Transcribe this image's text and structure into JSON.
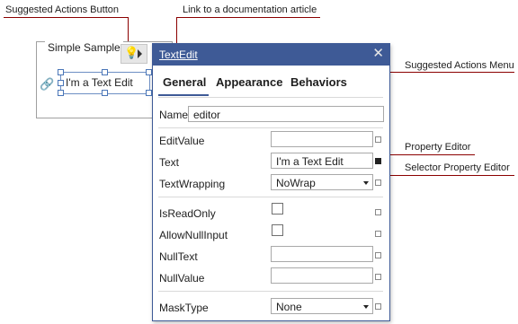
{
  "annotations": {
    "suggested_actions_button": "Suggested Actions Button",
    "link_to_doc": "Link to a documentation article",
    "suggested_actions_menu": "Suggested Actions Menu",
    "property_editor": "Property Editor",
    "selector_property_editor": "Selector Property Editor"
  },
  "designer": {
    "group_title": "Simple Sample",
    "text_edit_value": "I'm a Text Edit"
  },
  "menu": {
    "title": "TextEdit",
    "close": "✕",
    "tabs": [
      "General",
      "Appearance",
      "Behaviors"
    ],
    "name_label": "Name",
    "name_value": "editor",
    "properties": {
      "edit_value": {
        "label": "EditValue",
        "value": ""
      },
      "text": {
        "label": "Text",
        "value": "I'm a Text Edit"
      },
      "text_wrapping": {
        "label": "TextWrapping",
        "value": "NoWrap"
      },
      "is_read_only": {
        "label": "IsReadOnly"
      },
      "allow_null_input": {
        "label": "AllowNullInput"
      },
      "null_text": {
        "label": "NullText",
        "value": ""
      },
      "null_value": {
        "label": "NullValue",
        "value": ""
      },
      "mask_type": {
        "label": "MaskType",
        "value": "None"
      }
    }
  },
  "colors": {
    "header": "#3e5a96",
    "callout_line": "#8b0000",
    "lightbulb": "#e0b400"
  }
}
